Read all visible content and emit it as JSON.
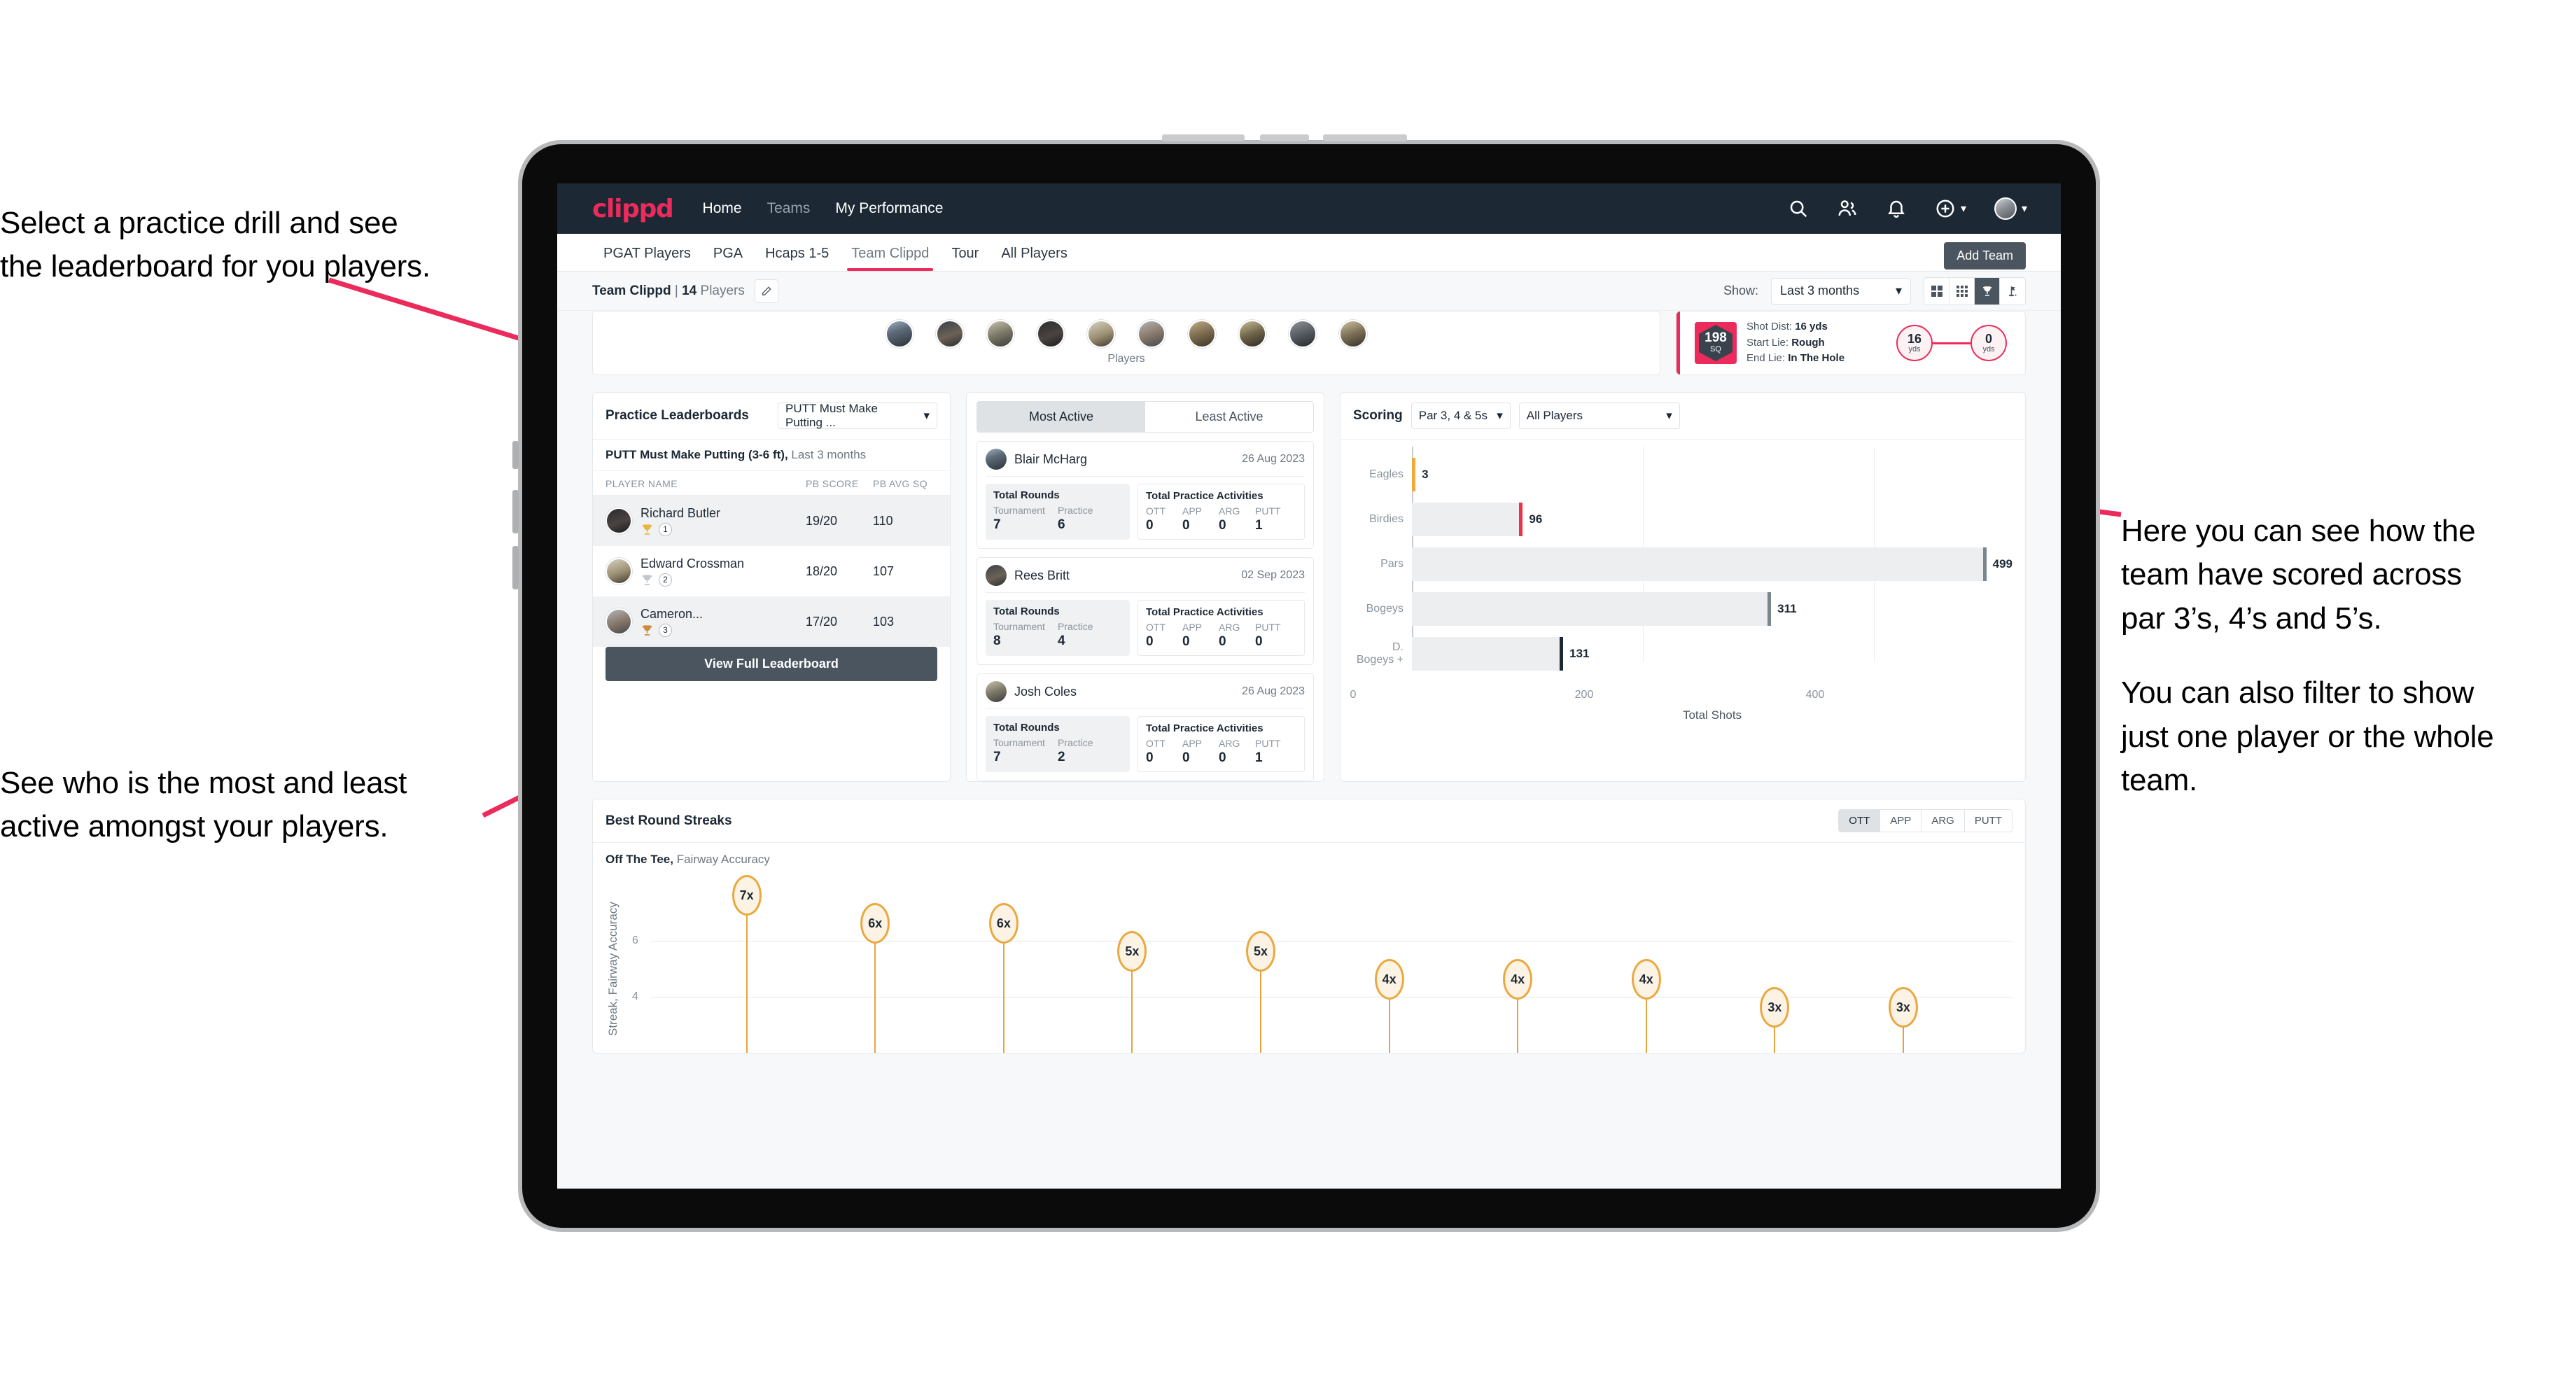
{
  "annotations": {
    "top_left": [
      "Select a practice drill and see",
      "the leaderboard for you players."
    ],
    "mid_left": [
      "See who is the most and least",
      "active amongst your players."
    ],
    "right_p1": [
      "Here you can see how the",
      "team have scored across",
      "par 3’s, 4’s and 5’s."
    ],
    "right_p2": [
      "You can also filter to show",
      "just one player or the whole",
      "team."
    ]
  },
  "navbar": {
    "logo": "clippd",
    "links": [
      {
        "label": "Home",
        "dim": false
      },
      {
        "label": "Teams",
        "dim": true
      },
      {
        "label": "My Performance",
        "dim": false
      }
    ],
    "icons": [
      "search-icon",
      "people-icon",
      "bell-icon",
      "plus-circle-icon",
      "avatar"
    ]
  },
  "tabs": [
    {
      "label": "PGAT Players",
      "active": false
    },
    {
      "label": "PGA",
      "active": false
    },
    {
      "label": "Hcaps 1-5",
      "active": false
    },
    {
      "label": "Team Clippd",
      "active": true
    },
    {
      "label": "Tour",
      "active": false
    },
    {
      "label": "All Players",
      "active": false
    }
  ],
  "add_team_button": "Add Team",
  "toolbar": {
    "team_name": "Team Clippd",
    "separator": " | ",
    "player_count": "14",
    "players_word": " Players",
    "show_label": "Show:",
    "range_value": "Last 3 months",
    "view_toggle": [
      {
        "name": "grid-large-icon",
        "selected": false
      },
      {
        "name": "grid-small-icon",
        "selected": false
      },
      {
        "name": "trophy-icon",
        "selected": true
      },
      {
        "name": "flag-icon",
        "selected": false
      }
    ]
  },
  "players_strip": {
    "label": "Players",
    "count": 10
  },
  "shot_card": {
    "sq_value": "198",
    "sq_unit": "SQ",
    "lines": [
      {
        "key": "Shot Dist: ",
        "value": "16 yds"
      },
      {
        "key": "Start Lie: ",
        "value": "Rough"
      },
      {
        "key": "End Lie: ",
        "value": "In The Hole"
      }
    ],
    "start_dot": {
      "value": "16",
      "unit": "yds"
    },
    "end_dot": {
      "value": "0",
      "unit": "yds"
    }
  },
  "leaderboard": {
    "title": "Practice Leaderboards",
    "drill_select": "PUTT Must Make Putting ...",
    "subtitle_bold": "PUTT Must Make Putting (3-6 ft),",
    "subtitle_rest": " Last 3 months",
    "columns": [
      "PLAYER NAME",
      "PB SCORE",
      "PB AVG SQ"
    ],
    "rows": [
      {
        "name": "Richard Butler",
        "rank": "1",
        "medal": "gold",
        "score": "19/20",
        "avg": "110",
        "highlight": true
      },
      {
        "name": "Edward Crossman",
        "rank": "2",
        "medal": "silver",
        "score": "18/20",
        "avg": "107",
        "highlight": false
      },
      {
        "name": "Cameron...",
        "rank": "3",
        "medal": "bronze",
        "score": "17/20",
        "avg": "103",
        "highlight": true
      }
    ],
    "view_full_button": "View Full Leaderboard"
  },
  "activity": {
    "tabs": [
      {
        "label": "Most Active",
        "selected": true
      },
      {
        "label": "Least Active",
        "selected": false
      }
    ],
    "rounds_title": "Total Rounds",
    "rounds_cols": [
      "Tournament",
      "Practice"
    ],
    "practice_title": "Total Practice Activities",
    "practice_cols": [
      "OTT",
      "APP",
      "ARG",
      "PUTT"
    ],
    "players": [
      {
        "name": "Blair McHarg",
        "date": "26 Aug 2023",
        "rounds": [
          "7",
          "6"
        ],
        "practice": [
          "0",
          "0",
          "0",
          "1"
        ]
      },
      {
        "name": "Rees Britt",
        "date": "02 Sep 2023",
        "rounds": [
          "8",
          "4"
        ],
        "practice": [
          "0",
          "0",
          "0",
          "0"
        ]
      },
      {
        "name": "Josh Coles",
        "date": "26 Aug 2023",
        "rounds": [
          "7",
          "2"
        ],
        "practice": [
          "0",
          "0",
          "0",
          "1"
        ]
      }
    ]
  },
  "scoring": {
    "title": "Scoring",
    "par_select": "Par 3, 4 & 5s",
    "player_select": "All Players"
  },
  "streaks": {
    "title": "Best Round Streaks",
    "segments": [
      {
        "label": "OTT",
        "selected": true
      },
      {
        "label": "APP",
        "selected": false
      },
      {
        "label": "ARG",
        "selected": false
      },
      {
        "label": "PUTT",
        "selected": false
      }
    ],
    "sub_bold": "Off The Tee,",
    "sub_rest": " Fairway Accuracy"
  },
  "colors": {
    "brand_pink": "#ec2a5b",
    "navy": "#1c2834",
    "slate": "#4a5560",
    "gold": "#eaa83f",
    "bar_grey": "#eceef0"
  },
  "chart_data": [
    {
      "type": "bar",
      "orientation": "horizontal",
      "title": "Scoring",
      "categories": [
        "Eagles",
        "Birdies",
        "Pars",
        "Bogeys",
        "D. Bogeys +"
      ],
      "values": [
        3,
        96,
        499,
        311,
        131
      ],
      "cap_colors": [
        "#f0a93a",
        "#e8334a",
        "#7b858e",
        "#7b858e",
        "#1c2834"
      ],
      "xlabel": "Total Shots",
      "ylabel": "",
      "xlim": [
        0,
        520
      ],
      "xticks": [
        0,
        200,
        400
      ],
      "grid": true,
      "legend": "none"
    },
    {
      "type": "scatter",
      "variant": "lollipop",
      "title": "Best Round Streaks",
      "subtitle": "Off The Tee, Fairway Accuracy",
      "ylabel": "Streak, Fairway Accuracy",
      "xlabel": "",
      "yticks": [
        4,
        6
      ],
      "ylim": [
        2,
        8
      ],
      "grid": true,
      "labels": [
        "7x",
        "6x",
        "6x",
        "5x",
        "5x",
        "4x",
        "4x",
        "4x",
        "3x",
        "3x"
      ],
      "values": [
        7,
        6,
        6,
        5,
        5,
        4,
        4,
        4,
        3,
        3
      ]
    }
  ]
}
